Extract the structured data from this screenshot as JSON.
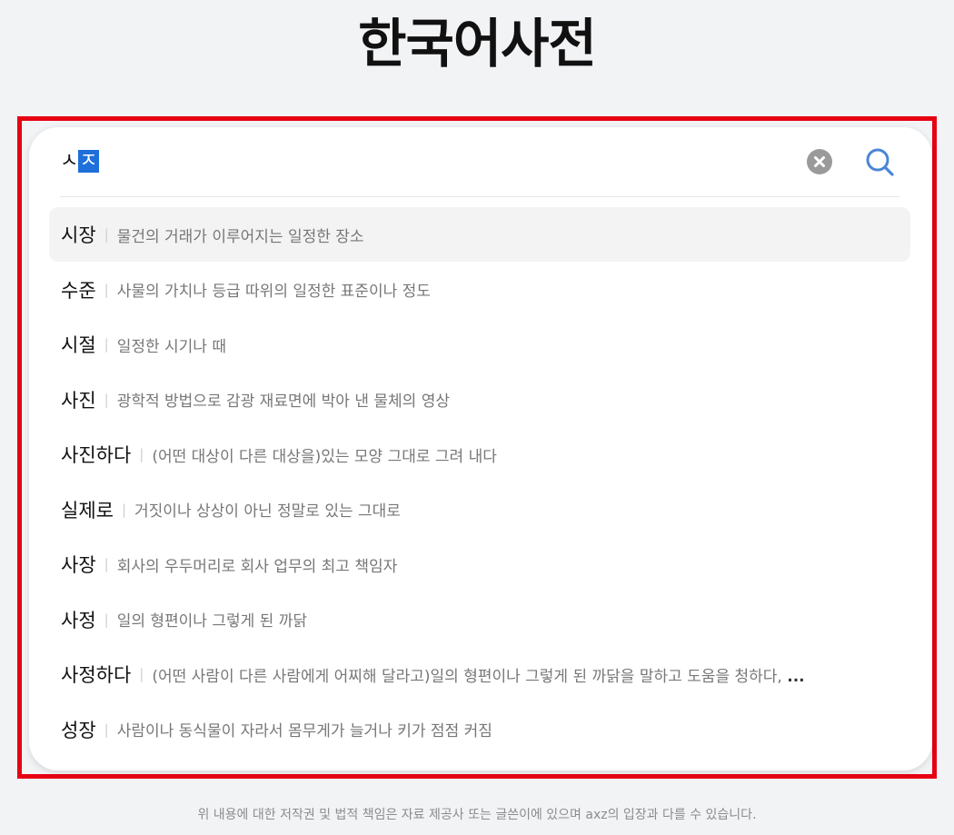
{
  "page": {
    "title": "한국어사전",
    "footer": "위 내용에 대한 저작권 및 법적 책임은 자료 제공사 또는 글쓴이에 있으며 axz의 입장과 다를 수 있습니다."
  },
  "search": {
    "committed_text": "ㅅ",
    "composing_text": "ㅈ",
    "clear_icon": "circle-x-icon",
    "search_icon": "magnifier-icon",
    "accent_color": "#4a86d6"
  },
  "suggestions": [
    {
      "word": "시장",
      "definition": "물건의 거래가 이루어지는 일정한 장소"
    },
    {
      "word": "수준",
      "definition": "사물의 가치나 등급 따위의 일정한 표준이나 정도"
    },
    {
      "word": "시절",
      "definition": "일정한 시기나 때"
    },
    {
      "word": "사진",
      "definition": "광학적 방법으로 감광 재료면에 박아 낸 물체의 영상"
    },
    {
      "word": "사진하다",
      "definition": "(어떤 대상이 다른 대상을)있는 모양 그대로 그려 내다"
    },
    {
      "word": "실제로",
      "definition": "거짓이나 상상이 아닌 정말로 있는 그대로"
    },
    {
      "word": "사장",
      "definition": "회사의 우두머리로 회사 업무의 최고 책임자"
    },
    {
      "word": "사정",
      "definition": "일의 형편이나 그렇게 된 까닭"
    },
    {
      "word": "사정하다",
      "definition": "(어떤 사람이 다른 사람에게 어찌해 달라고)일의 형편이나 그렇게 된 까닭을 말하고 도움을 청하다,",
      "ellipsis": "..."
    },
    {
      "word": "성장",
      "definition": "사람이나 동식물이 자라서 몸무게가 늘거나 키가 점점 커짐"
    }
  ],
  "separator": "|",
  "highlight_color": "#e60012"
}
